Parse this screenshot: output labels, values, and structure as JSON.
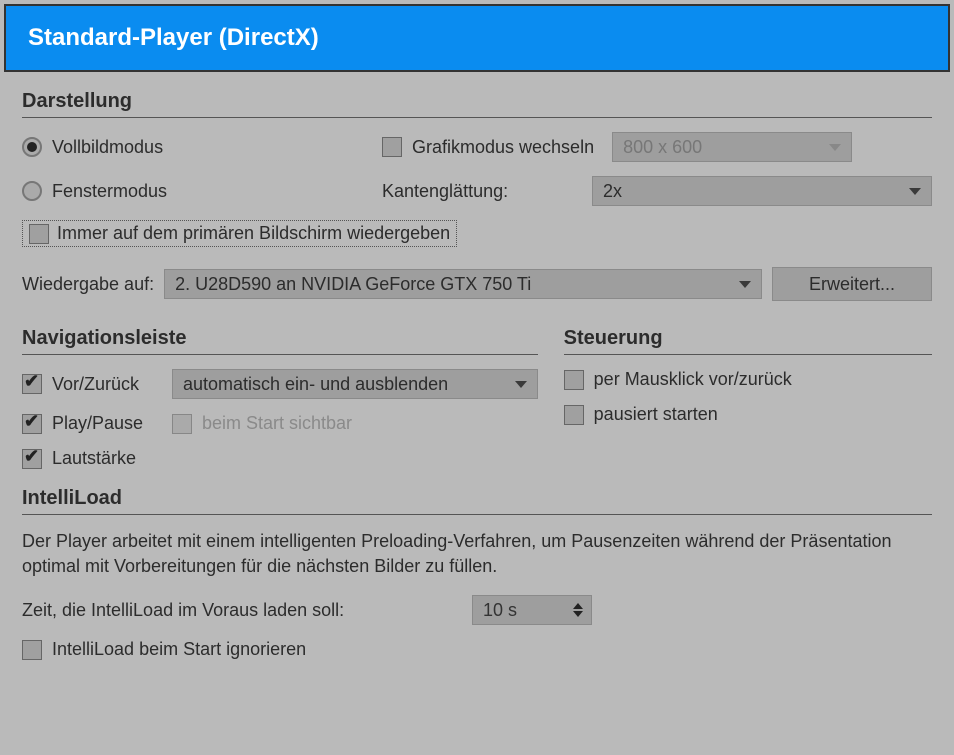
{
  "header": {
    "title": "Standard-Player (DirectX)"
  },
  "display": {
    "section_title": "Darstellung",
    "fullscreen": "Vollbildmodus",
    "windowed": "Fenstermodus",
    "switch_mode": "Grafikmodus wechseln",
    "resolution": "800 x 600",
    "antialias_label": "Kantenglättung:",
    "antialias_value": "2x",
    "always_primary": "Immer auf dem primären Bildschirm wiedergeben",
    "playback_on_label": "Wiedergabe auf:",
    "playback_on_value": "2. U28D590 an NVIDIA GeForce GTX 750 Ti",
    "extended": "Erweitert..."
  },
  "nav": {
    "section_title": "Navigationsleiste",
    "prev_next": "Vor/Zurück",
    "prev_next_mode": "automatisch ein- und ausblenden",
    "play_pause": "Play/Pause",
    "visible_on_start": "beim Start sichtbar",
    "volume": "Lautstärke"
  },
  "control": {
    "section_title": "Steuerung",
    "mouse_click": "per Mausklick vor/zurück",
    "start_paused": "pausiert starten"
  },
  "intelliload": {
    "section_title": "IntelliLoad",
    "description": "Der Player arbeitet mit einem intelligenten Preloading-Verfahren, um Pausenzeiten während der Präsentation optimal mit Vorbereitungen für die nächsten Bilder zu füllen.",
    "preload_label": "Zeit, die IntelliLoad im Voraus laden soll:",
    "preload_value": "10 s",
    "ignore_on_start": "IntelliLoad beim Start ignorieren"
  }
}
